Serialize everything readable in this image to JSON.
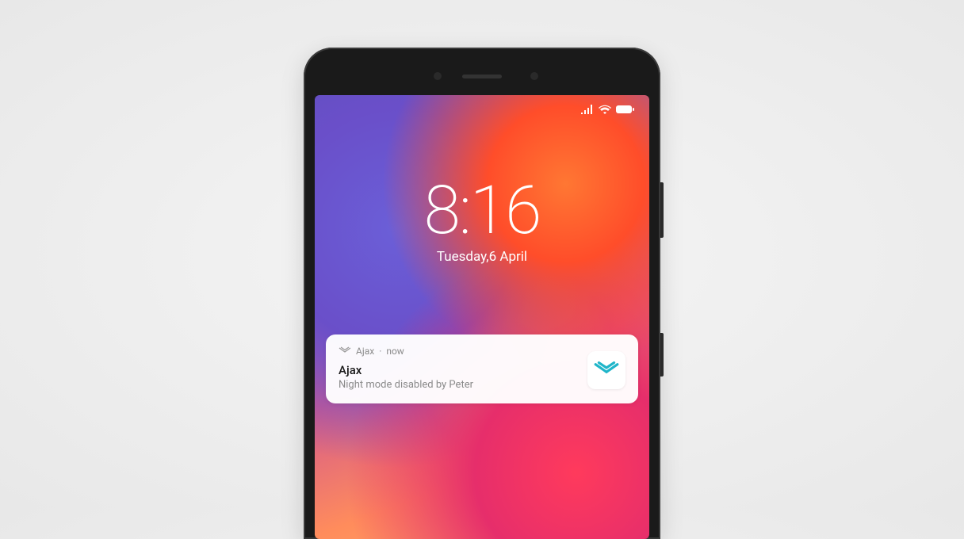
{
  "statusbar": {
    "signal_icon": "signal-icon",
    "wifi_icon": "wifi-icon",
    "battery_icon": "battery-icon"
  },
  "lockscreen": {
    "time": "8:16",
    "date": "Tuesday,6 April"
  },
  "notification": {
    "app_name": "Ajax",
    "timestamp": "now",
    "title": "Ajax",
    "message": "Night mode disabled by Peter"
  }
}
